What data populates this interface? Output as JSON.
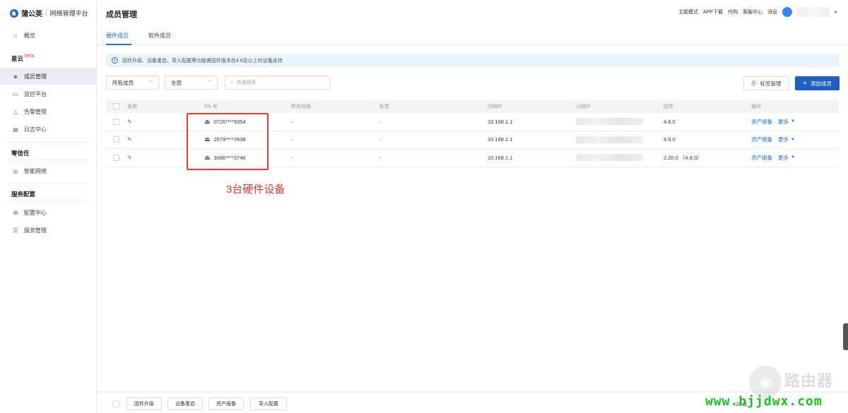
{
  "brand": {
    "name": "蒲公英",
    "platform": "网络管理平台"
  },
  "sidebar": {
    "overview": "概览",
    "group_starcloud": "星云",
    "beta": "beta",
    "members": "成员管理",
    "monitor": "监控平台",
    "alarm": "告警管理",
    "logs": "日志中心",
    "group_zerotrust": "零信任",
    "smartnet": "智能网络",
    "group_service": "服务配置",
    "config": "配置中心",
    "services": "服务管理"
  },
  "header": {
    "title": "成员管理",
    "links": [
      "主题模式",
      "APP下载",
      "代购",
      "客服中心",
      "消息"
    ]
  },
  "tabs": {
    "hardware": "硬件成员",
    "software": "软件成员"
  },
  "notice": "固件升级、设备重启、导入配置等功能需固件版本在4.8及以上的设备支持",
  "filters": {
    "member_type": "所有成员",
    "scope": "全部",
    "search_placeholder": "快速搜索"
  },
  "buttons": {
    "tag_manage": "标签管理",
    "add_member": "添加成员"
  },
  "table": {
    "headers": [
      "名称",
      "SN 号",
      "所在网络",
      "标签",
      "内网IP",
      "公网IP",
      "固件",
      "操作"
    ],
    "rows": [
      {
        "sn": "0726****9354",
        "network": "-",
        "tag": "-",
        "lan_ip": "10.168.1.1",
        "firmware": "4.8.0",
        "action": "资产报备",
        "more": "更多"
      },
      {
        "sn": "2079****7838",
        "network": "-",
        "tag": "-",
        "lan_ip": "10.168.1.1",
        "firmware": "4.9.0",
        "action": "资产报备",
        "more": "更多"
      },
      {
        "sn": "3066****3746",
        "network": "-",
        "tag": "-",
        "lan_ip": "10.168.1.1",
        "firmware": "2.20.0 （4.8.0）",
        "action": "资产报备",
        "more": "更多"
      }
    ]
  },
  "annotation": "3台硬件设备",
  "bottom": {
    "buttons": [
      "固件升级",
      "设备重启",
      "资产报备",
      "导入配置"
    ],
    "page_size": "20",
    "page_unit": "条"
  },
  "watermark": {
    "title": "路由器",
    "url": "www.bjjdwx.com"
  }
}
